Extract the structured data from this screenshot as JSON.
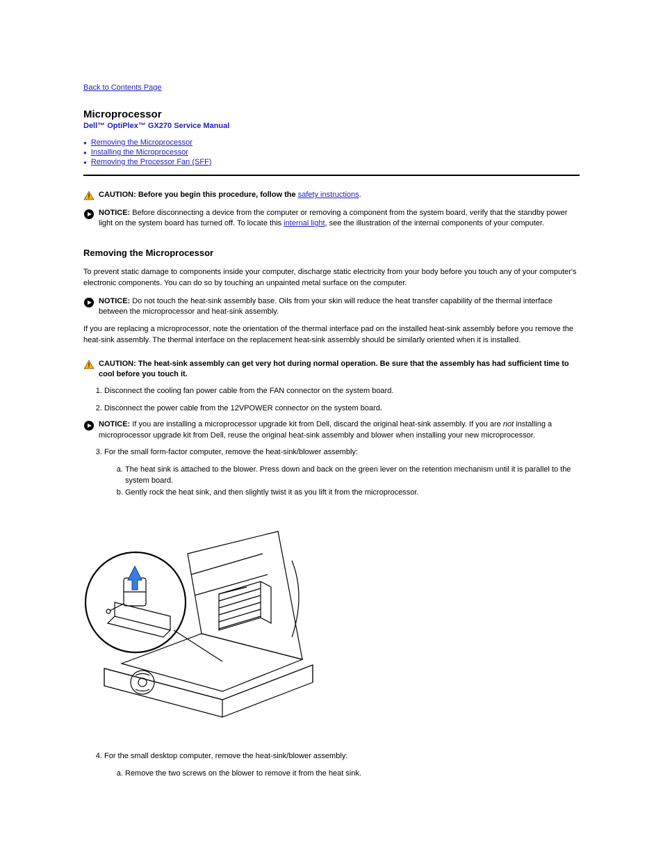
{
  "nav": {
    "back_label": "Back to Contents Page"
  },
  "header": {
    "page_title": "Microprocessor",
    "manual_name": "Dell™ OptiPlex™ GX270 Service Manual"
  },
  "toc": {
    "items": [
      {
        "label": "Removing the Microprocessor"
      },
      {
        "label": "Installing the Microprocessor"
      },
      {
        "label": "Removing the Processor Fan (SFF)"
      }
    ]
  },
  "notices": {
    "caution1": {
      "bold": "CAUTION: Before you begin this procedure, follow the ",
      "link": "safety instructions",
      "after": "."
    },
    "notice1": {
      "bold": "NOTICE:",
      "text": " Before disconnecting a device from the computer or removing a component from the system board, verify that the standby power light on the system board has turned off. To locate this ",
      "link": "internal light",
      "after": ", see the illustration of the internal components of your computer."
    },
    "notice2": {
      "bold": "NOTICE:",
      "text": " Do not touch the heat-sink assembly base. Oils from your skin will reduce the heat transfer capability of the thermal interface between the microprocessor and heat-sink assembly."
    },
    "caution2": {
      "bold": "CAUTION: The heat-sink assembly can get very hot during normal operation. Be sure that the assembly has had sufficient time to cool before you touch it."
    },
    "notice3": {
      "bold": "NOTICE:",
      "text": " If you are installing a microprocessor upgrade kit from Dell, discard the original heat-sink assembly. If you are ",
      "italic": "not",
      "after_italic": " installing a microprocessor upgrade kit from Dell, reuse the original heat-sink assembly and blower when installing your new microprocessor."
    }
  },
  "sections": {
    "removing_title": "Removing the Microprocessor",
    "intro_para": "To prevent static damage to components inside your computer, discharge static electricity from your body before you touch any of your computer's electronic components. You can do so by touching an unpainted metal surface on the computer.",
    "replace_para": "If you are replacing a microprocessor, note the orientation of the thermal interface pad on the installed heat-sink assembly before you remove the heat-sink assembly. The thermal interface on the replacement heat-sink assembly should be similarly oriented when it is installed."
  },
  "steps": {
    "s1": "Disconnect the cooling fan power cable from the FAN connector on the system board.",
    "s2": "Disconnect the power cable from the 12VPOWER connector on the system board.",
    "s3": "For the small form-factor computer, remove the heat-sink/blower assembly:",
    "s3a": "The heat sink is attached to the blower. Press down and back on the green lever on the retention mechanism until it is parallel to the system board.",
    "s3b": "Gently rock the heat sink, and then slightly twist it as you lift it from the microprocessor.",
    "s4": "For the small desktop computer, remove the heat-sink/blower assembly:",
    "s4a": "Remove the two screws on the blower to remove it from the heat sink."
  }
}
